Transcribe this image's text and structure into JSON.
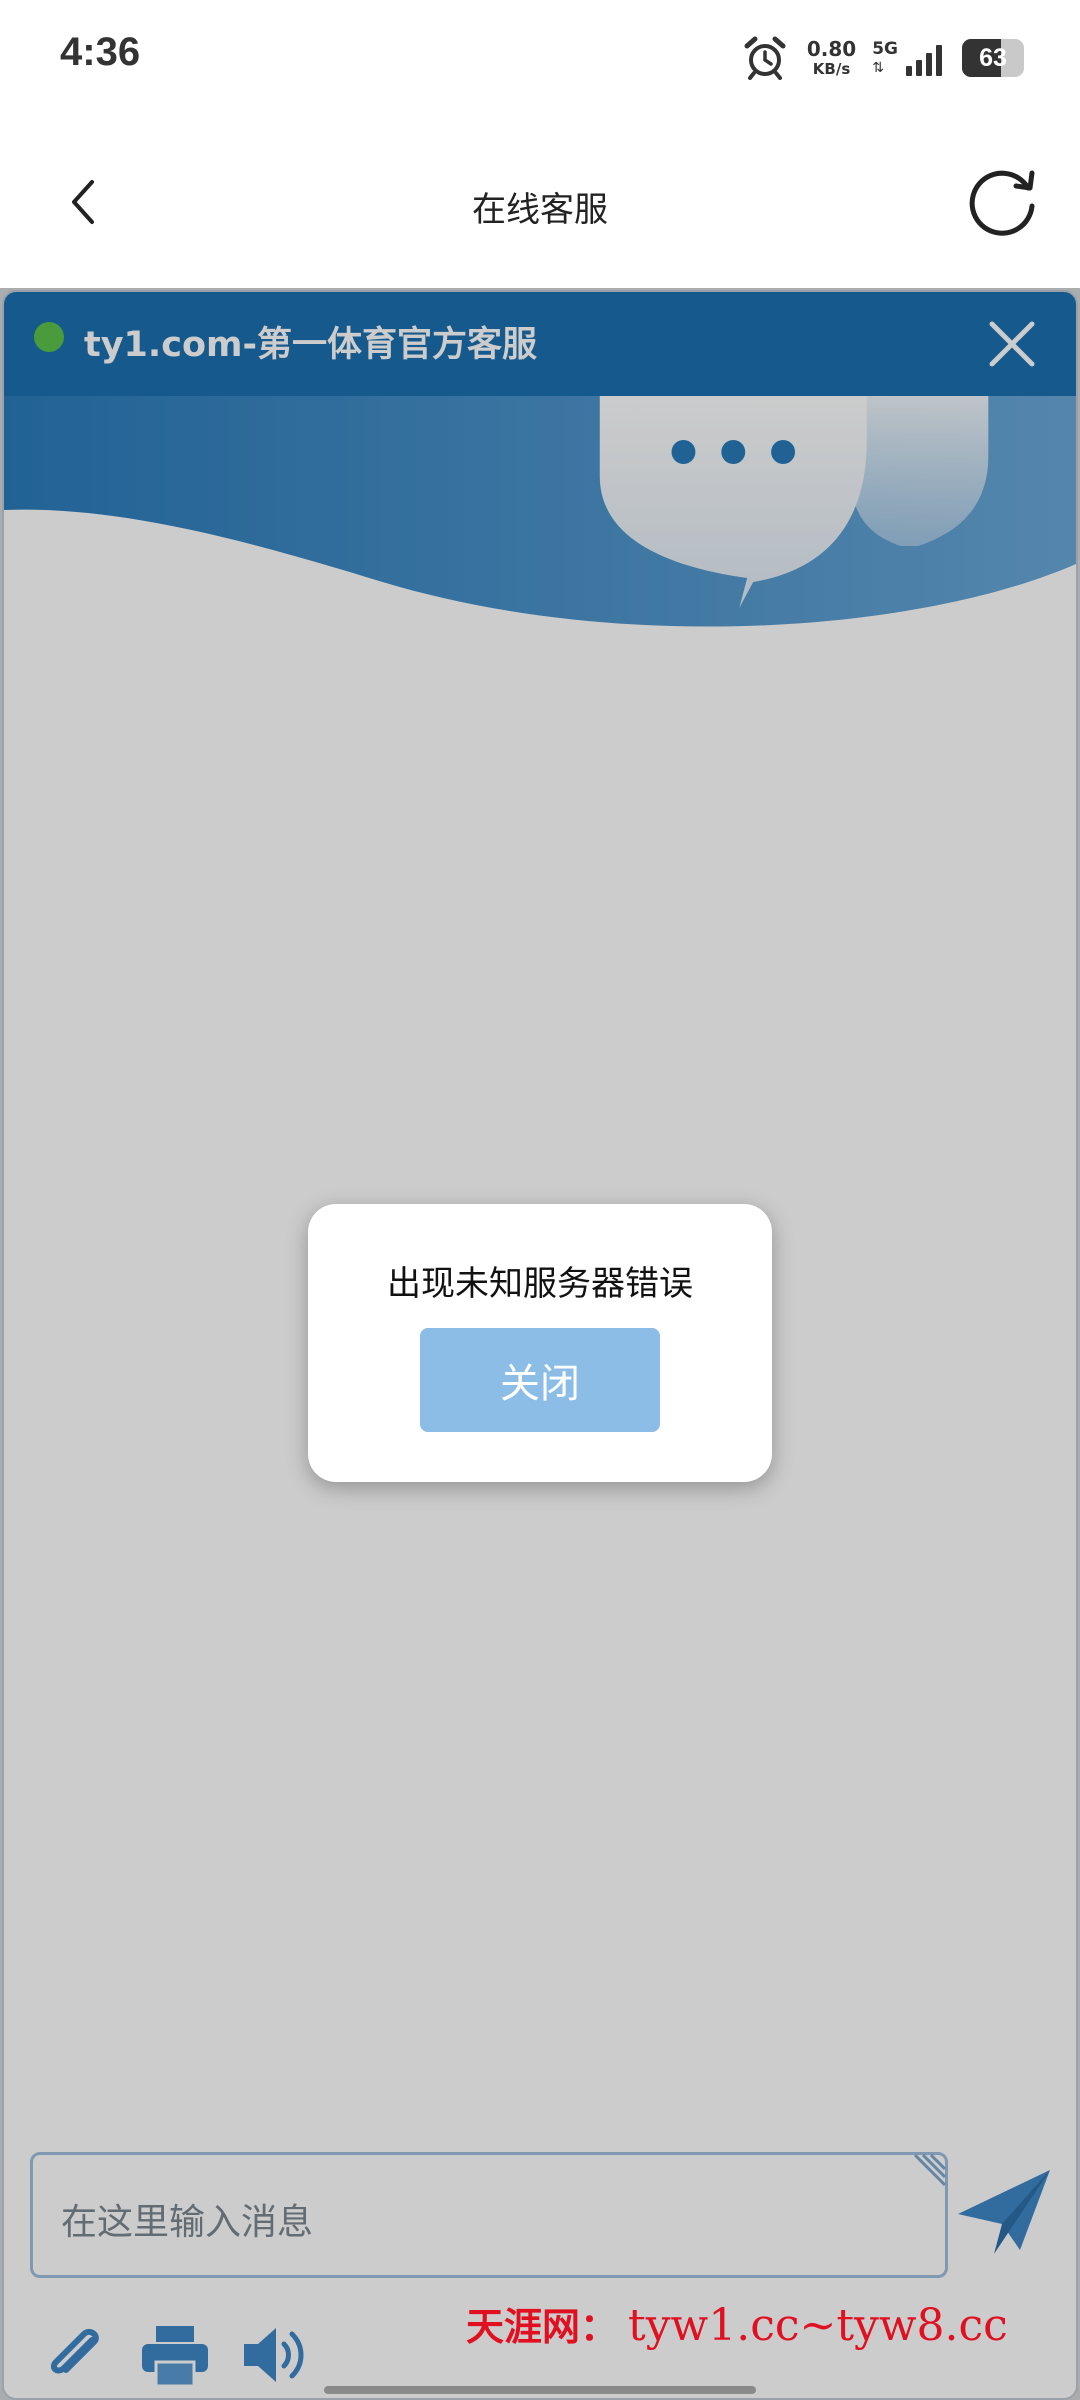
{
  "status_bar": {
    "time": "4:36",
    "net_speed_value": "0.80",
    "net_speed_unit": "KB/s",
    "network_type": "5G",
    "battery_level": "63"
  },
  "header": {
    "title": "在线客服",
    "back_icon": "chevron-left-icon",
    "refresh_icon": "refresh-icon"
  },
  "chat": {
    "title": "ty1.com-第一体育官方客服",
    "status_color": "#5cc24a",
    "header_color": "#1c70b0",
    "input_placeholder": "在这里输入消息",
    "toolbar_icons": [
      "paperclip-icon",
      "printer-icon",
      "speaker-icon"
    ]
  },
  "dialog": {
    "message": "出现未知服务器错误",
    "close_label": "关闭",
    "button_color": "#8bbde7"
  },
  "watermark": {
    "label": "天涯网：",
    "urls": "tyw1.cc~tyw8.cc"
  }
}
